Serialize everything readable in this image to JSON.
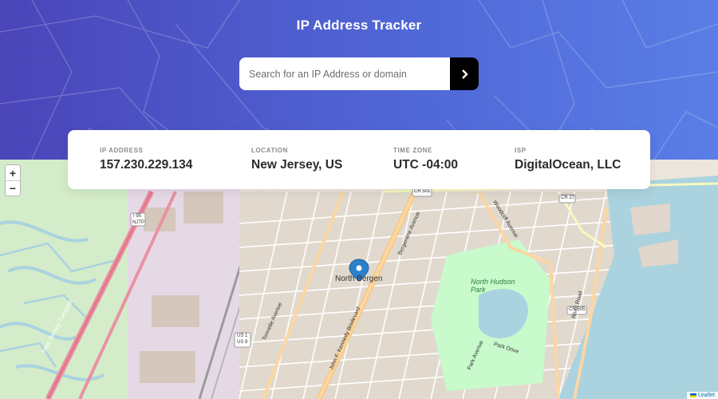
{
  "app": {
    "title": "IP Address Tracker"
  },
  "search": {
    "placeholder": "Search for an IP Address or domain",
    "value": ""
  },
  "info": {
    "ip": {
      "label": "IP ADDRESS",
      "value": "157.230.229.134"
    },
    "location": {
      "label": "LOCATION",
      "value": "New Jersey, US"
    },
    "timezone": {
      "label": "TIME ZONE",
      "value": "UTC -04:00"
    },
    "isp": {
      "label": "ISP",
      "value": "DigitalOcean, LLC"
    }
  },
  "map": {
    "zoom_in": "+",
    "zoom_out": "−",
    "attribution": "Leaflet",
    "labels": {
      "city": "North Bergen",
      "park": "North Hudson Park",
      "turnpike": "New Jersey Turnpike",
      "route_us1": "US 1",
      "route_us9": "US 9",
      "route_i95": "I 95",
      "route_njtp": "NJTP",
      "route_cr501": "CR 501",
      "route_cr27": "CR 27",
      "route_cr505": "CR 505",
      "blvd": "John F. Kennedy Boulevard",
      "bergenline": "Bergenline Avenue",
      "tonnelle": "Tonnelle Avenue",
      "park_ave": "Park Avenue",
      "river_road": "River Road",
      "park_drive": "Park Drive",
      "woodcliff": "Woodcliff Avenue"
    }
  },
  "icons": {
    "search_button": "chevron-right-icon",
    "marker": "map-pin-icon"
  },
  "colors": {
    "header_start": "#4a45b8",
    "header_end": "#5a7ee6",
    "marker": "#2a81cb",
    "water": "#aad3df",
    "park": "#c8facc"
  }
}
